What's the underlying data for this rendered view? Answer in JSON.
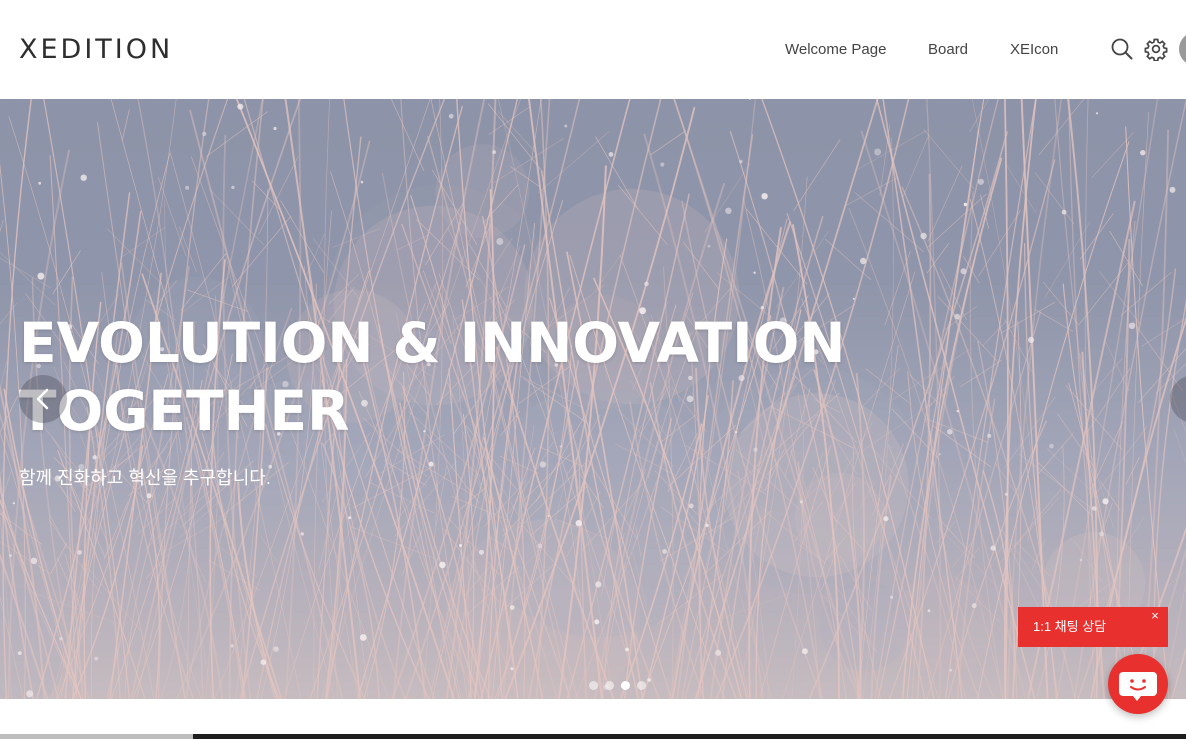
{
  "header": {
    "logo": "XEDITION",
    "nav": {
      "welcome": "Welcome Page",
      "board": "Board",
      "xeicon": "XEIcon"
    },
    "icons": {
      "search": "search-icon",
      "settings": "gear-icon",
      "avatar": "avatar"
    }
  },
  "hero": {
    "title_line1": "EVOLUTION & INNOVATION",
    "title_line2": "TOGETHER",
    "subtitle": "함께 진화하고 혁신을 추구합니다.",
    "slides": {
      "count": 4,
      "active_index": 2
    },
    "colors": {
      "sky": "#8f95aa",
      "grass": "#e3c4bf"
    }
  },
  "chat": {
    "label": "1:1 채팅 상담",
    "close": "×",
    "color": "#e8312f"
  }
}
